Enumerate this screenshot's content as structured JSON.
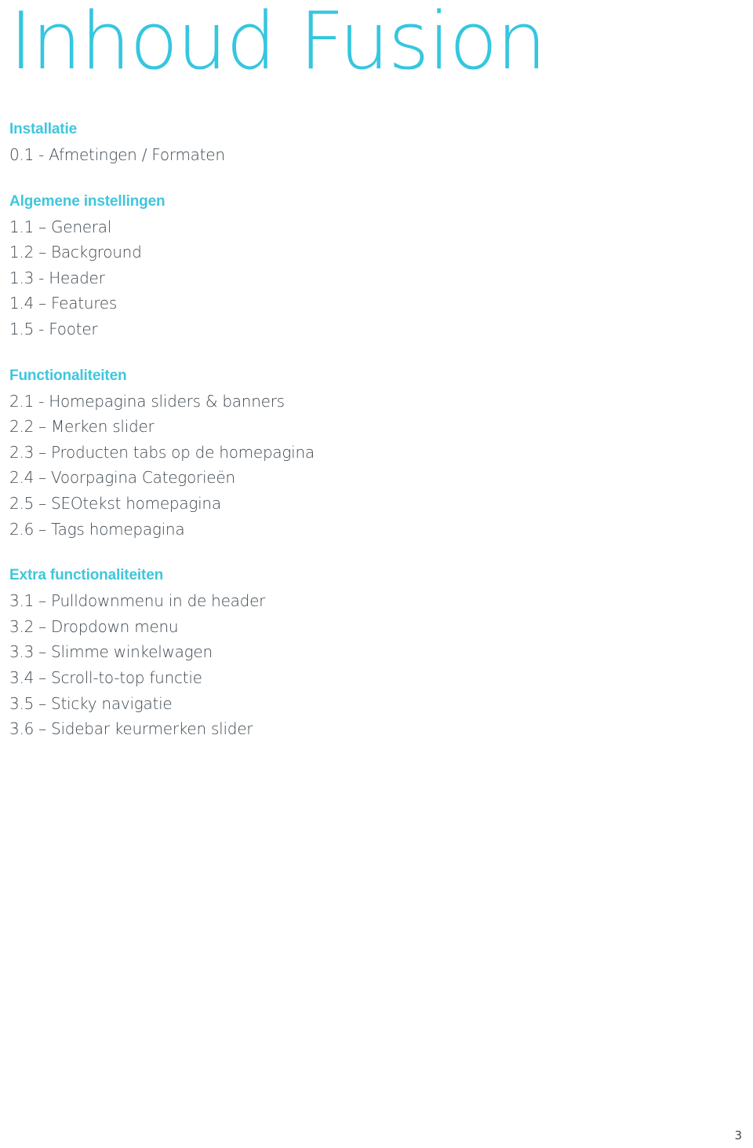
{
  "document": {
    "title": "Inhoud Fusion",
    "page_number": "3",
    "colors": {
      "title": "#35c6e0",
      "heading": "#3fc6dc",
      "body_text": "#3e4850",
      "background": "#ffffff"
    }
  },
  "toc": {
    "sections": [
      {
        "heading": "Installatie",
        "items": [
          "0.1 - Afmetingen / Formaten"
        ]
      },
      {
        "heading": "Algemene instellingen",
        "items": [
          "1.1 – General",
          "1.2 – Background",
          "1.3 - Header",
          "1.4 – Features",
          "1.5 - Footer"
        ]
      },
      {
        "heading": "Functionaliteiten",
        "items": [
          "2.1 - Homepagina sliders & banners",
          "2.2 – Merken slider",
          "2.3 – Producten tabs op de homepagina",
          "2.4 – Voorpagina Categorieën",
          "2.5 – SEOtekst homepagina",
          "2.6 – Tags homepagina"
        ]
      },
      {
        "heading": "Extra functionaliteiten",
        "items": [
          "3.1 – Pulldownmenu in de header",
          "3.2 – Dropdown menu",
          "3.3 – Slimme winkelwagen",
          "3.4 – Scroll-to-top functie",
          "3.5 – Sticky navigatie",
          "3.6 – Sidebar keurmerken slider"
        ]
      }
    ]
  }
}
